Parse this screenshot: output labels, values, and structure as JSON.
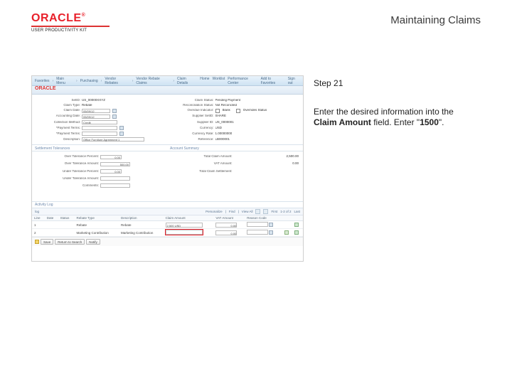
{
  "header": {
    "logo_text": "ORACLE",
    "subbrand": "USER PRODUCTIVITY KIT",
    "page_title": "Maintaining Claims"
  },
  "side": {
    "step": "Step 21",
    "instr_pre": "Enter the desired information into the ",
    "instr_field": "Claim Amount",
    "instr_mid": " field. Enter \"",
    "instr_value": "1500",
    "instr_post": "\"."
  },
  "ss": {
    "crumbs": [
      "Favorites",
      "Main Menu",
      "Purchasing",
      "Vendor Rebates",
      "Vendor Rebate Claims",
      "Claim Details"
    ],
    "toplinks": [
      "Home",
      "Worklist",
      "Performance Center",
      "Add to Favorites",
      "Sign out"
    ],
    "oracle": "ORACLE",
    "form_left": [
      {
        "label": "SetID",
        "value": "US_00000XXYZ"
      },
      {
        "label": "Claim Type",
        "value": "Rebate"
      },
      {
        "label": "Claim Date",
        "value": "05/09/12",
        "input": 40,
        "icon": true
      },
      {
        "label": "Accounting Date",
        "value": "05/09/12",
        "input": 40,
        "icon": true
      },
      {
        "label": "Collection Method",
        "value": "Credit",
        "input": 50
      },
      {
        "label": "*Payment Terms",
        "value": "",
        "input": 50,
        "icon": true
      },
      {
        "label": "*Payment Terms",
        "value": "",
        "input": 50,
        "icon": true
      },
      {
        "label": "Description",
        "value": "Office Furniture Agreement 1",
        "input": 88
      }
    ],
    "form_right": [
      {
        "label": "Claim Status",
        "value": "Pending Payment"
      },
      {
        "label": "Reconciliation Status",
        "value": "Not Reconciled"
      },
      {
        "label": "Overdue Indicator",
        "value": "Blank",
        "chk": true,
        "chk_label": "Overrides Status"
      },
      {
        "label": "Supplier SetID",
        "value": "SHARE"
      },
      {
        "label": "Supplier ID",
        "value": "US_0000001"
      },
      {
        "label": "Currency",
        "value": "USD"
      },
      {
        "label": "Currency Rate",
        "value": "1.00000000"
      },
      {
        "label": "Reference",
        "value": "LB000001"
      }
    ],
    "section_left": "Settlement Tolerances",
    "section_right": "Account Summary",
    "form2_left": [
      {
        "label": "Over Tolerance Percent",
        "value": "0.00",
        "input": 30
      },
      {
        "label": "Over Tolerance Amount",
        "value": "500.00",
        "input": 42
      },
      {
        "label": "Under Tolerance Percent",
        "value": "0.00",
        "input": 30
      },
      {
        "label": "Under Tolerance Amount",
        "value": "",
        "input": 42
      },
      {
        "label": "Comments",
        "value": "",
        "input": 42
      }
    ],
    "form2_right": [
      {
        "label": "Total Claim Amount",
        "value": "2,500.00"
      },
      {
        "label": "VAT Amount",
        "value": "0.00"
      },
      {
        "label": "Total Claim Settlement",
        "value": ""
      }
    ],
    "activity": {
      "title": "Activity Log",
      "bar": {
        "personalize": "Personalize",
        "find": "Find",
        "view": "View All",
        "first": "First",
        "range": "1-2 of 2",
        "last": "Last"
      },
      "cols": [
        "Line",
        "Date",
        "Status",
        "Rebate Type",
        "Description",
        "Claim Amount",
        "VAT Amount",
        "Reason Code",
        "",
        ""
      ],
      "rows": [
        {
          "line": "1",
          "date": "",
          "status": "",
          "rtype": "Rebate",
          "desc": "Rebate",
          "claim": "2,500 USD",
          "vat": "0.00",
          "open": false,
          "hl": false
        },
        {
          "line": "2",
          "date": "",
          "status": "",
          "rtype": "Marketing Contribution",
          "desc": "Marketing Contribution",
          "claim": "",
          "vat": "0.00",
          "open": true,
          "hl": true
        }
      ],
      "buttons": [
        "Save",
        "Return to Search",
        "Notify"
      ]
    }
  }
}
